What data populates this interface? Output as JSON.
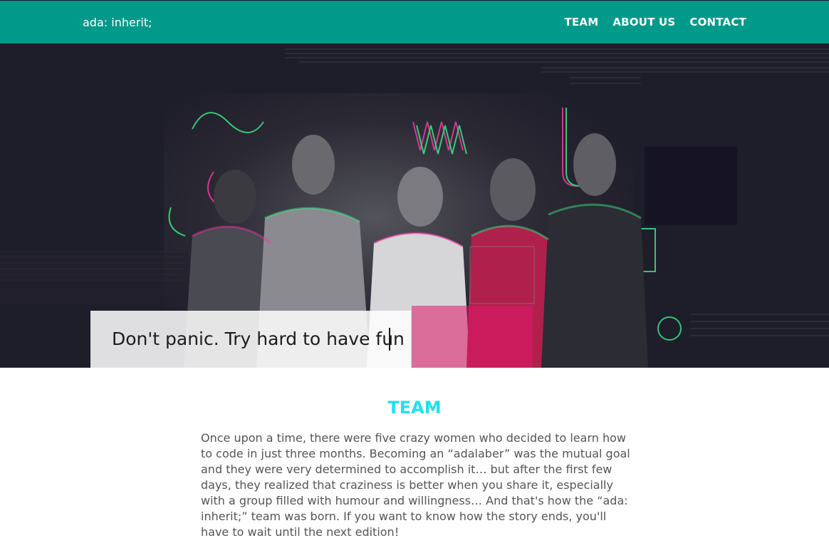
{
  "header": {
    "logo": "ada: inherit;",
    "nav": [
      "TEAM",
      "ABOUT US",
      "CONTACT"
    ]
  },
  "hero": {
    "quote": "Don't panic. Try hard to have fun"
  },
  "team": {
    "title": "TEAM",
    "body": "Once upon a time, there were five crazy women who decided to learn how to code in just three months. Becoming an “adalaber” was the mutual goal and they were very determined to accomplish it… but after the first few days, they realized that craziness is better when you share it, especially with a group filled with humour and willingness… And that's how the “ada: inherit;” team was born. If you want to know how the story ends, you'll have to wait until the next edition!"
  },
  "colors": {
    "header_bg": "#00998a",
    "accent_title": "#22e0ee",
    "hero_bg": "#1e1d2a"
  }
}
